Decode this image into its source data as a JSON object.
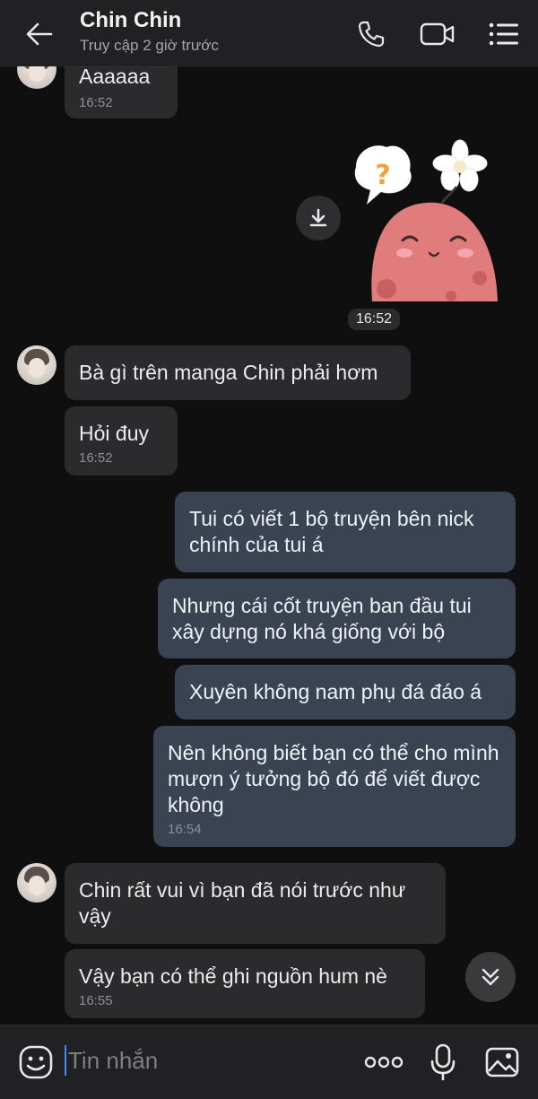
{
  "header": {
    "title": "Chin Chin",
    "subtitle": "Truy cập 2 giờ trước",
    "icons": [
      "back-arrow-icon",
      "phone-icon",
      "video-camera-icon",
      "menu-list-icon"
    ]
  },
  "messages": [
    {
      "side": "in",
      "text": "Aaaaaa",
      "time": "16:52"
    },
    {
      "side": "out",
      "type": "sticker",
      "time": "16:52"
    },
    {
      "side": "in",
      "text": "Bà gì trên manga Chin phải hơm"
    },
    {
      "side": "in",
      "text": "Hỏi đuy",
      "time": "16:52"
    },
    {
      "side": "out",
      "text": "Tui có viết 1 bộ truyện bên nick chính của tui á"
    },
    {
      "side": "out",
      "text": "Nhưng cái cốt truyện ban đầu tui xây dựng nó khá giống với bộ"
    },
    {
      "side": "out",
      "text": "Xuyên không nam phụ đá đáo á"
    },
    {
      "side": "out",
      "text": "Nên không biết bạn có thể cho mình mượn ý tưởng bộ đó để viết được không",
      "time": "16:54"
    },
    {
      "side": "in",
      "text": "Chin rất vui vì bạn đã nói trước như vậy"
    },
    {
      "side": "in",
      "text": "Vậy bạn có thể ghi nguồn hum nè",
      "time": "16:55"
    }
  ],
  "input": {
    "placeholder": "Tin nhắn"
  },
  "colors": {
    "background": "#0f0f10",
    "header": "#212123",
    "incoming_bubble": "#2b2b2e",
    "outgoing_bubble": "#3a4352",
    "cursor": "#3e8cf4"
  }
}
